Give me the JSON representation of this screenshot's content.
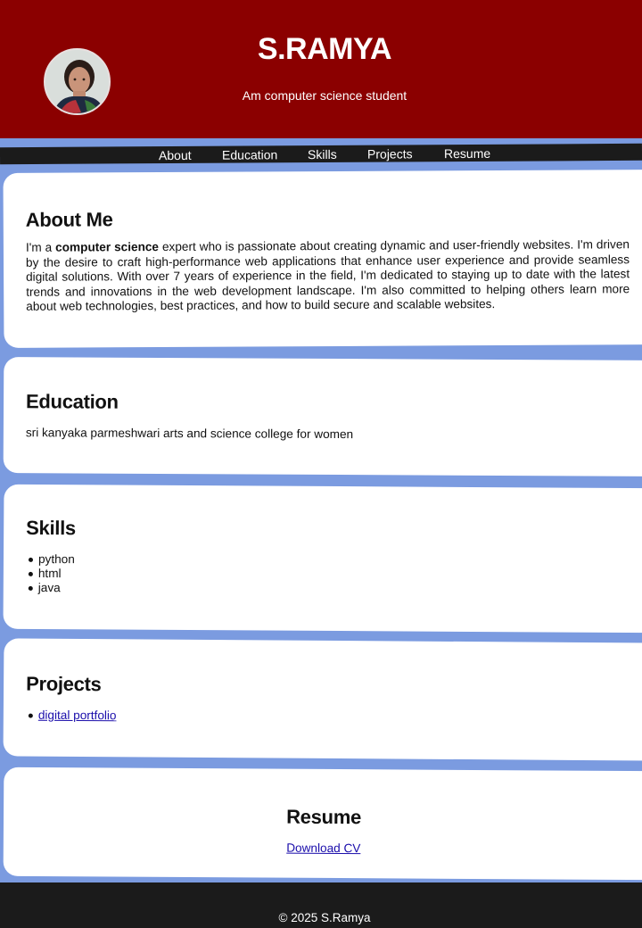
{
  "header": {
    "name": "S.RAMYA",
    "tagline": "Am computer science student"
  },
  "nav": {
    "items": [
      "About",
      "Education",
      "Skills",
      "Projects",
      "Resume"
    ]
  },
  "about": {
    "heading": "About Me",
    "intro": "I'm a ",
    "emphasis": "computer science",
    "body": " expert who is passionate about creating dynamic and user-friendly websites. I'm driven by the desire to craft high-performance web applications that enhance user experience and provide seamless digital solutions. With over 7 years of experience in the field, I'm dedicated to staying up to date with the latest trends and innovations in the web development landscape. I'm also committed to helping others learn more about web technologies, best practices, and how to build secure and scalable websites."
  },
  "education": {
    "heading": "Education",
    "text": "sri kanyaka parmeshwari arts and science college for women"
  },
  "skills": {
    "heading": "Skills",
    "items": [
      "python",
      "html",
      "java"
    ]
  },
  "projects": {
    "heading": "Projects",
    "items": [
      "digital portfolio"
    ]
  },
  "resume": {
    "heading": "Resume",
    "link": "Download CV"
  },
  "footer": {
    "copyright": "© 2025 S.Ramya"
  },
  "colors": {
    "header_bg": "#8b0000",
    "page_bg": "#7b9be0",
    "nav_bg": "#1b1b1b",
    "link": "#1a0dab"
  }
}
